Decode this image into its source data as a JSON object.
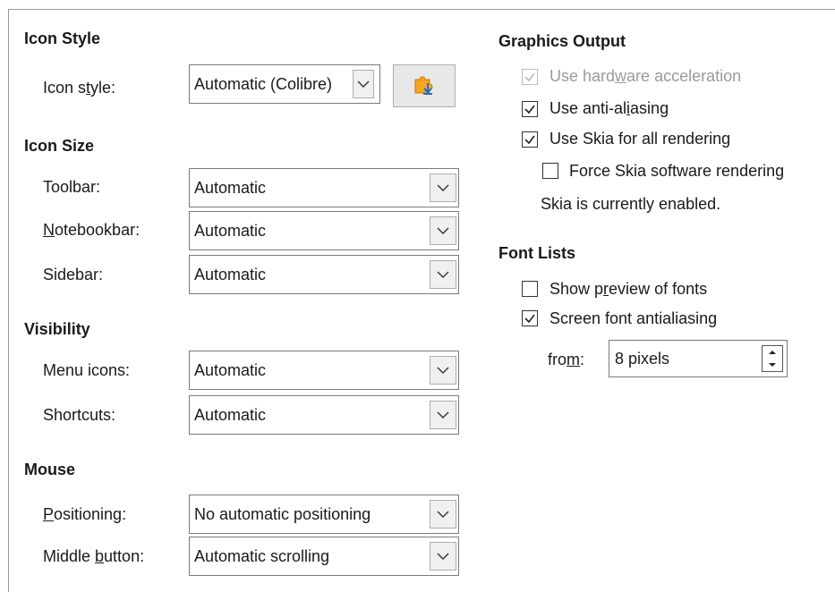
{
  "left": {
    "icon_style": {
      "heading": "Icon Style",
      "label_pre": "Icon s",
      "label_u": "t",
      "label_post": "yle:",
      "value": "Automatic (Colibre)"
    },
    "icon_size": {
      "heading": "Icon Size",
      "toolbar": {
        "label": "Toolbar:",
        "value": "Automatic"
      },
      "notebookbar": {
        "label_u": "N",
        "label_post": "otebookbar:",
        "value": "Automatic"
      },
      "sidebar": {
        "label": "Sidebar:",
        "value": "Automatic"
      }
    },
    "visibility": {
      "heading": "Visibility",
      "menu_icons": {
        "label": "Menu icons:",
        "value": "Automatic"
      },
      "shortcuts": {
        "label": "Shortcuts:",
        "value": "Automatic"
      }
    },
    "mouse": {
      "heading": "Mouse",
      "positioning": {
        "label_u": "P",
        "label_post": "ositioning:",
        "value": "No automatic positioning"
      },
      "middle_button": {
        "label_pre": "Middle ",
        "label_u": "b",
        "label_post": "utton:",
        "value": "Automatic scrolling"
      }
    }
  },
  "right": {
    "graphics": {
      "heading": "Graphics Output",
      "hw_accel": {
        "pre": "Use hard",
        "u": "w",
        "post": "are acceleration",
        "checked": true,
        "enabled": false
      },
      "anti_alias": {
        "pre": "Use anti-al",
        "u": "i",
        "post": "asing",
        "checked": true
      },
      "skia": {
        "label": "Use Skia for all rendering",
        "checked": true
      },
      "skia_sw": {
        "label": "Force Skia software rendering",
        "checked": false
      },
      "skia_status": "Skia is currently enabled."
    },
    "fonts": {
      "heading": "Font Lists",
      "preview": {
        "pre": "Show p",
        "u": "r",
        "post": "eview of fonts",
        "checked": false
      },
      "screen_aa": {
        "pre": "Screen font antialiasin",
        "u": "g",
        "post": "",
        "checked": true
      },
      "from": {
        "pre": "fro",
        "u": "m",
        "post": ":",
        "value": "8 pixels"
      }
    }
  },
  "icons": {
    "dropdown": "chevron-down-icon",
    "extension": "add-icon-theme-icon",
    "check": "checkmark-icon"
  }
}
